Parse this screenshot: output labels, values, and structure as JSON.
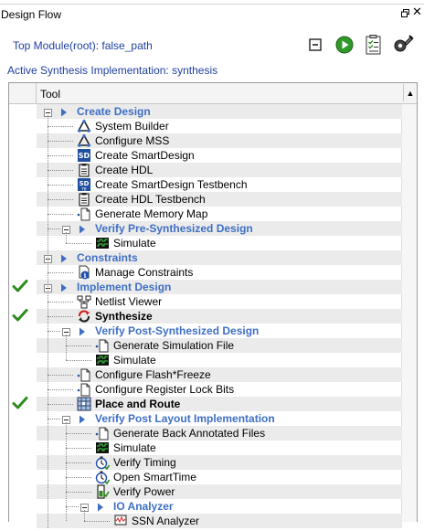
{
  "panel": {
    "title": "Design Flow",
    "restore_icon": "restore-window-icon",
    "close_icon": "close-icon"
  },
  "top_module": {
    "label": "Top Module(root): false_path"
  },
  "active_impl": {
    "label": "Active Synthesis Implementation: synthesis"
  },
  "toolbar": [
    {
      "name": "collapse-all-icon"
    },
    {
      "name": "run-icon"
    },
    {
      "name": "report-icon"
    },
    {
      "name": "configure-tool-icon"
    }
  ],
  "table": {
    "column_header": "Tool",
    "sort_icon": "sort-up-icon"
  },
  "colors": {
    "category": "#3f6fc4",
    "accent": "#1f3f9f",
    "check": "#2e8b1e",
    "stripe": "#ebebeb"
  },
  "tree": [
    {
      "label": "Create Design",
      "level": 0,
      "type": "category",
      "expander": "minus",
      "icon": "expand-arrow-icon"
    },
    {
      "label": "System Builder",
      "level": 1,
      "type": "tool",
      "icon": "system-builder-icon"
    },
    {
      "label": "Configure MSS",
      "level": 1,
      "type": "tool",
      "icon": "system-builder-icon"
    },
    {
      "label": "Create SmartDesign",
      "level": 1,
      "type": "tool",
      "icon": "sd-icon"
    },
    {
      "label": "Create HDL",
      "level": 1,
      "type": "tool",
      "icon": "clipboard-icon"
    },
    {
      "label": "Create SmartDesign Testbench",
      "level": 1,
      "type": "tool",
      "icon": "sd-testbench-icon"
    },
    {
      "label": "Create HDL Testbench",
      "level": 1,
      "type": "tool",
      "icon": "clipboard-icon"
    },
    {
      "label": "Generate Memory Map",
      "level": 1,
      "type": "tool",
      "icon": "file-icon"
    },
    {
      "label": "Verify Pre-Synthesized Design",
      "level": 1,
      "type": "category",
      "expander": "minus",
      "icon": "expand-arrow-icon"
    },
    {
      "label": "Simulate",
      "level": 2,
      "type": "tool",
      "icon": "simulate-icon"
    },
    {
      "label": "Constraints",
      "level": 0,
      "type": "category",
      "expander": "minus",
      "icon": "expand-arrow-icon"
    },
    {
      "label": "Manage Constraints",
      "level": 1,
      "type": "tool",
      "icon": "constraints-icon"
    },
    {
      "label": "Implement Design",
      "level": 0,
      "type": "category",
      "expander": "minus",
      "icon": "expand-arrow-icon",
      "checked": true
    },
    {
      "label": "Netlist Viewer",
      "level": 1,
      "type": "tool",
      "icon": "netlist-icon"
    },
    {
      "label": "Synthesize",
      "level": 1,
      "type": "tool",
      "bold": true,
      "icon": "synthesize-icon",
      "checked": true
    },
    {
      "label": "Verify Post-Synthesized Design",
      "level": 1,
      "type": "category",
      "expander": "minus",
      "icon": "expand-arrow-icon"
    },
    {
      "label": "Generate Simulation File",
      "level": 2,
      "type": "tool",
      "icon": "file-icon"
    },
    {
      "label": "Simulate",
      "level": 2,
      "type": "tool",
      "icon": "simulate-icon"
    },
    {
      "label": "Configure Flash*Freeze",
      "level": 1,
      "type": "tool",
      "icon": "file-icon"
    },
    {
      "label": "Configure Register Lock Bits",
      "level": 1,
      "type": "tool",
      "icon": "file-icon"
    },
    {
      "label": "Place and Route",
      "level": 1,
      "type": "tool",
      "bold": true,
      "icon": "place-route-icon",
      "checked": true
    },
    {
      "label": "Verify Post Layout Implementation",
      "level": 1,
      "type": "category",
      "expander": "minus",
      "icon": "expand-arrow-icon"
    },
    {
      "label": "Generate Back Annotated Files",
      "level": 2,
      "type": "tool",
      "icon": "file-icon"
    },
    {
      "label": "Simulate",
      "level": 2,
      "type": "tool",
      "icon": "simulate-icon"
    },
    {
      "label": "Verify Timing",
      "level": 2,
      "type": "tool",
      "icon": "timing-icon"
    },
    {
      "label": "Open SmartTime",
      "level": 2,
      "type": "tool",
      "icon": "timing-icon"
    },
    {
      "label": "Verify Power",
      "level": 2,
      "type": "tool",
      "icon": "power-icon"
    },
    {
      "label": "IO Analyzer",
      "level": 2,
      "type": "category",
      "expander": "minus",
      "icon": "expand-arrow-icon"
    },
    {
      "label": "SSN Analyzer",
      "level": 3,
      "type": "tool",
      "icon": "ssn-icon"
    }
  ]
}
